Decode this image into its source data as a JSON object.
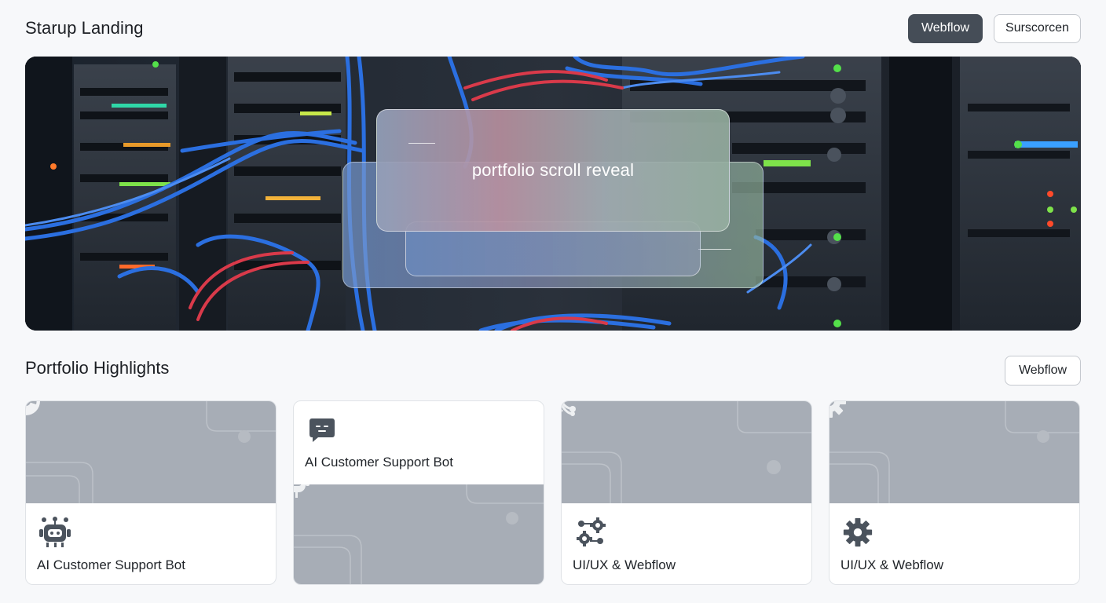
{
  "header": {
    "title": "Starup Landing",
    "buttons": [
      {
        "label": "Webflow",
        "style": "dark"
      },
      {
        "label": "Surscorcen",
        "style": "light"
      }
    ]
  },
  "hero": {
    "caption": "portfolio scroll reveal",
    "background": "server-rack-photo"
  },
  "section": {
    "title": "Portfolio Highlights",
    "button_label": "Webflow"
  },
  "cards": [
    {
      "label": "AI Customer Support Bot",
      "thumb_icon": "pie-chart-icon",
      "icon": "robot-icon"
    },
    {
      "label": "AI Customer Support Bot",
      "thumb_icon": "robot-head-icon",
      "icon": "chat-bubble-icon"
    },
    {
      "label": "UI/UX & Webflow",
      "thumb_icon": "network-nodes-icon",
      "icon": "gears-icon"
    },
    {
      "label": "UI/UX & Webflow",
      "thumb_icon": "gear-icon",
      "icon": "gear-icon"
    }
  ],
  "colors": {
    "background": "#f7f8fa",
    "button_dark": "#454d57",
    "thumb_gray": "#a7adb6",
    "icon_dark": "#4b535d"
  }
}
